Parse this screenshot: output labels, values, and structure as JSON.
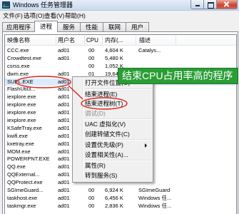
{
  "window": {
    "title": "Windows 任务管理器",
    "icon": "task-manager-icon"
  },
  "window_controls": {
    "minimize": "minimize-icon",
    "maximize": "maximize-icon",
    "close": "close-icon"
  },
  "menubar": {
    "items": [
      "文件(F)",
      "选项(O)",
      "查看(V)",
      "帮助(H)"
    ]
  },
  "tabs": {
    "items": [
      "应用程序",
      "进程",
      "服务",
      "性能",
      "联网",
      "用户"
    ],
    "selected": "进程"
  },
  "process_table": {
    "columns": [
      "映像名称",
      "用户名",
      "CPU",
      "内存(...",
      "描述"
    ],
    "selected_process": "SUEL.EXE",
    "rows": [
      {
        "name": "CCC.exe",
        "user": "ad01",
        "cpu": "00",
        "memory": "4,604 K",
        "description": "Catalys..."
      },
      {
        "name": "Crowdtest.exe",
        "user": "ad01",
        "cpu": "00",
        "memory": "5,480 K",
        "description": ""
      },
      {
        "name": "csrss.exe",
        "user": "",
        "cpu": "00",
        "memory": "1,052 K",
        "description": ""
      },
      {
        "name": "dwm.exe",
        "user": "ad01",
        "cpu": "01",
        "memory": "19,64",
        "description": ""
      },
      {
        "name": "SUEL.EXE",
        "user": "ad01",
        "cpu": "",
        "memory": "",
        "description": ""
      },
      {
        "name": "FlashUtil3...",
        "user": "ad01",
        "cpu": "",
        "memory": "",
        "description": ""
      },
      {
        "name": "iexplore.exe",
        "user": "ad01",
        "cpu": "",
        "memory": "",
        "description": ""
      },
      {
        "name": "iexplore.exe",
        "user": "ad01",
        "cpu": "",
        "memory": "",
        "description": ""
      },
      {
        "name": "iexplore.exe",
        "user": "ad01",
        "cpu": "",
        "memory": "",
        "description": ""
      },
      {
        "name": "iexplore.exe",
        "user": "ad01",
        "cpu": "",
        "memory": "",
        "description": ""
      },
      {
        "name": "KSafeTray.exe",
        "user": "ad01",
        "cpu": "",
        "memory": "",
        "description": ""
      },
      {
        "name": "kwifi.exe",
        "user": "ad01",
        "cpu": "",
        "memory": "",
        "description": ""
      },
      {
        "name": "kxetray.exe",
        "user": "ad01",
        "cpu": "",
        "memory": "",
        "description": ""
      },
      {
        "name": "MOM.exe",
        "user": "ad01",
        "cpu": "",
        "memory": "",
        "description": ""
      },
      {
        "name": "POWERPNT.EXE",
        "user": "ad01",
        "cpu": "",
        "memory": "",
        "description": ""
      },
      {
        "name": "QQ.exe",
        "user": "ad01",
        "cpu": "",
        "memory": "",
        "description": ""
      },
      {
        "name": "QQExternal...",
        "user": "ad01",
        "cpu": "",
        "memory": "",
        "description": ""
      },
      {
        "name": "QQProtect.exe",
        "user": "ad01",
        "cpu": "",
        "memory": "",
        "description": ""
      },
      {
        "name": "SGImeGuard...",
        "user": "ad01",
        "cpu": "00",
        "memory": "6,924 K",
        "description": "SGImeGuard"
      },
      {
        "name": "taskhost.exe",
        "user": "ad01",
        "cpu": "00",
        "memory": "6,456 K",
        "description": "Windows 任..."
      },
      {
        "name": "taskmgr.exe",
        "user": "ad01",
        "cpu": "00",
        "memory": "2,836 K",
        "description": "Windows 任..."
      }
    ]
  },
  "context_menu": {
    "items": [
      {
        "label": "打开文件位置(O)"
      },
      {
        "separator": true
      },
      {
        "label": "结束进程(E)"
      },
      {
        "label": "结束进程树(T)"
      },
      {
        "label": "调试(D)",
        "disabled": true
      },
      {
        "separator": true
      },
      {
        "label": "UAC 虚拟化(V)"
      },
      {
        "label": "创建转储文件(C)"
      },
      {
        "separator": true
      },
      {
        "label": "设置优先级(P)",
        "submenu": true,
        "submenu_icon": "chevron-right-icon"
      },
      {
        "label": "设置相关性(A)..."
      },
      {
        "separator": true
      },
      {
        "label": "属性(R)"
      },
      {
        "label": "转到服务(S)"
      }
    ]
  },
  "annotation": {
    "banner_text": "结束CPU占用率高的程序"
  },
  "colors": {
    "banner_background": "#2a9d35",
    "banner_text": "#ffffff",
    "annotation_red": "#e32119",
    "selected_row": "#dcebfa",
    "close_button": "#c9432d"
  }
}
